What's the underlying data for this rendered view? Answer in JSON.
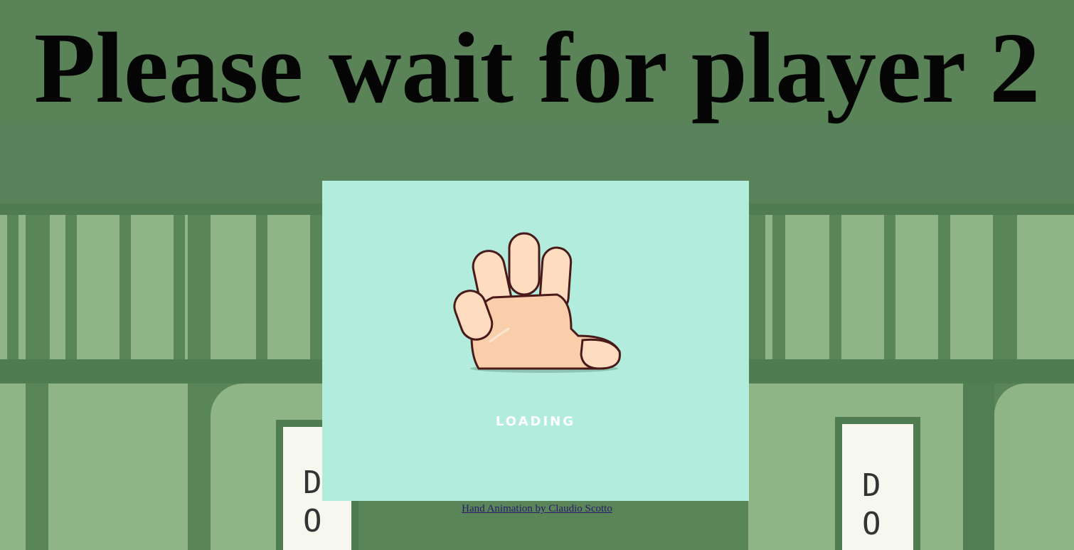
{
  "page": {
    "heading": "Please wait for player 2",
    "loader": {
      "icon": "waving-hand-icon",
      "status_text": "LOADING",
      "background_color": "#b2ecdc"
    },
    "credit_link": "Hand Animation by Claudio Scotto",
    "background": {
      "left_sign_text": "D\nO",
      "right_sign_text": "D\nO"
    }
  }
}
